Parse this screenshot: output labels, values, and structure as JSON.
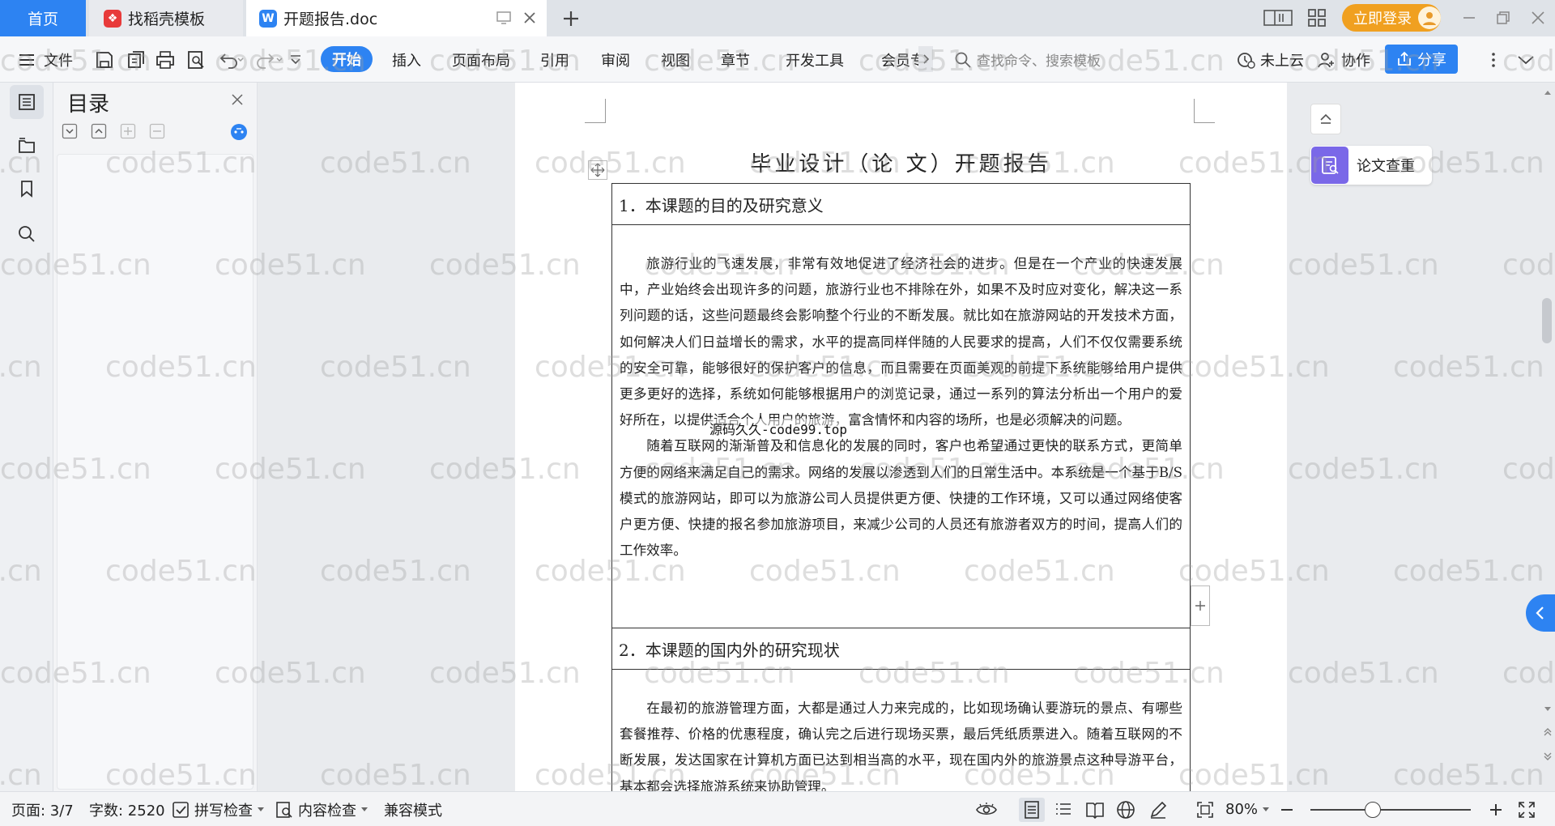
{
  "tabs": {
    "home": "首页",
    "daoke": "找稻壳模板",
    "doc": "开题报告.doc",
    "login": "立即登录"
  },
  "toolbar": {
    "file": "文件",
    "menus": [
      "开始",
      "插入",
      "页面布局",
      "引用",
      "审阅",
      "视图",
      "章节",
      "开发工具",
      "会员专"
    ],
    "search_placeholder": "查找命令、搜索模板",
    "cloud": "未上云",
    "collab": "协作",
    "share": "分享"
  },
  "toc": {
    "title": "目录"
  },
  "document": {
    "title": "毕业设计（论 文）开题报告",
    "sec1_head": "1．本课题的目的及研究意义",
    "sec1_p1": "旅游行业的飞速发展，非常有效地促进了经济社会的进步。但是在一个产业的快速发展中，产业始终会出现许多的问题，旅游行业也不排除在外，如果不及时应对变化，解决这一系列问题的话，这些问题最终会影响整个行业的不断发展。就比如在旅游网站的开发技术方面，如何解决人们日益增长的需求，水平的提高同样伴随的人民要求的提高，人们不仅仅需要系统的安全可靠，能够很好的保护客户的信息，而且需要在页面美观的前提下系统能够给用户提供更多更好的选择，系统如何能够根据用户的浏览记录，通过一系列的算法分析出一个用户的爱好所在，以提供适合个人用户的旅游，富含情怀和内容的场所，也是必须解决的问题。",
    "sec1_p2": "随着互联网的渐渐普及和信息化的发展的同时，客户也希望通过更快的联系方式，更简单方便的网络来满足自己的需求。网络的发展以渗透到人们的日常生活中。本系统是一个基于B/S模式的旅游网站，即可以为旅游公司人员提供更方便、快捷的工作环境，又可以通过网络使客户更方便、快捷的报名参加旅游项目，来减少公司的人员还有旅游者双方的时间，提高人们的工作效率。",
    "overlay_text": "源码久久-code99.top",
    "sec2_head": "2．本课题的国内外的研究现状",
    "sec2_p1": "在最初的旅游管理方面，大都是通过人力来完成的，比如现场确认要游玩的景点、有哪些套餐推荐、价格的优惠程度，确认完之后进行现场买票，最后凭纸质票进入。随着互联网的不断发展，发达国家在计算机方面已达到相当高的水平，现在国内外的旅游景点这种导游平台，基本都会选择旅游系统来协助管理。"
  },
  "right_panel": {
    "check_label": "论文查重"
  },
  "status": {
    "page": "页面: 3/7",
    "words": "字数: 2520",
    "spell": "拼写检查",
    "content": "内容检查",
    "compat": "兼容模式",
    "zoom": "80%"
  },
  "watermark": "code51.cn",
  "colors": {
    "accent": "#2d83f2",
    "login": "#f0a020",
    "check": "#7a68e8"
  }
}
